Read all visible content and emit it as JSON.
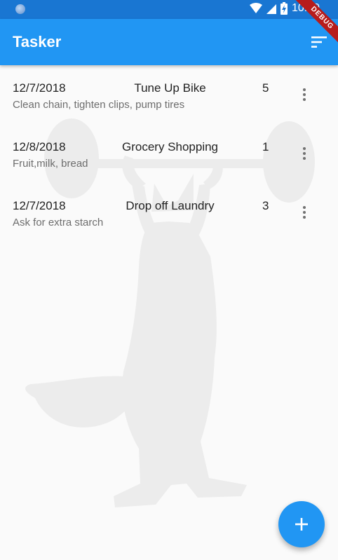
{
  "status_bar": {
    "time": "10:39"
  },
  "debug_banner": "DEBUG",
  "app_bar": {
    "title": "Tasker",
    "sort_icon": "sort-icon"
  },
  "tasks": [
    {
      "date": "12/7/2018",
      "title": "Tune Up Bike",
      "priority": "5",
      "description": "Clean chain, tighten clips, pump tires"
    },
    {
      "date": "12/8/2018",
      "title": "Grocery Shopping",
      "priority": "1",
      "description": "Fruit,milk, bread"
    },
    {
      "date": "12/7/2018",
      "title": "Drop off Laundry",
      "priority": "3",
      "description": "Ask for extra starch"
    }
  ],
  "fab": {
    "icon": "add-icon"
  },
  "colors": {
    "app_bar": "#2196f3",
    "status_bar": "#1976d2",
    "background": "#fafafa",
    "watermark": "#ececec"
  }
}
